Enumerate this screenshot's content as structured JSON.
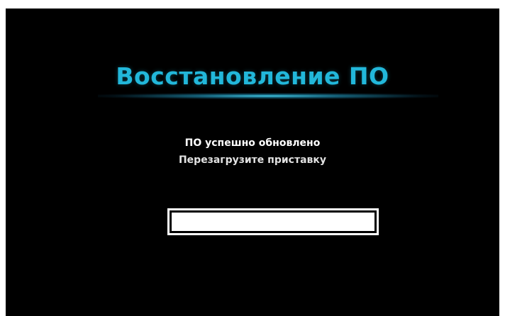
{
  "screen": {
    "title": "Восстановление ПО",
    "message_line1": "ПО успешно обновлено",
    "message_line2": "Перезагрузите приставку"
  },
  "progress": {
    "fraction": 1.0
  },
  "colors": {
    "background": "#000000",
    "title": "#22b7da",
    "text": "#ffffff"
  }
}
